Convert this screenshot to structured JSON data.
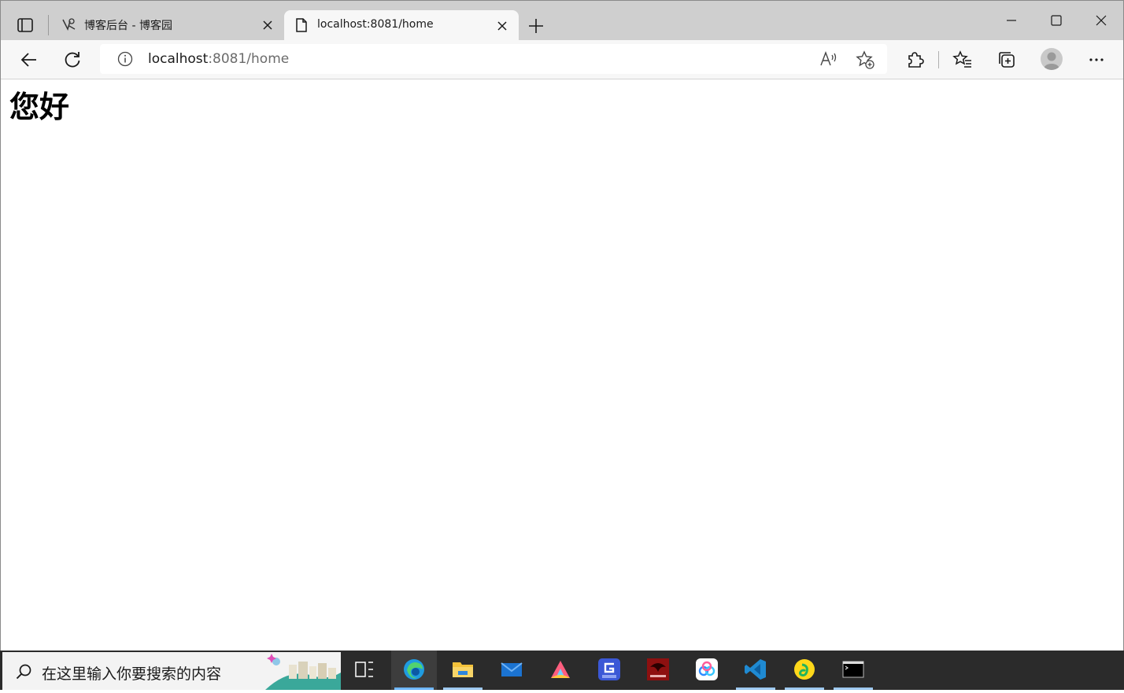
{
  "browser": {
    "tabs": [
      {
        "title": "博客后台 - 博客园",
        "active": false,
        "favicon": "cnblogs-icon"
      },
      {
        "title": "localhost:8081/home",
        "active": true,
        "favicon": "page-icon"
      }
    ],
    "address_bar": {
      "host": "localhost",
      "rest": ":8081/home"
    }
  },
  "page": {
    "heading": "您好"
  },
  "taskbar": {
    "search_placeholder": "在这里输入你要搜索的内容",
    "apps": [
      "task-view",
      "edge",
      "file-explorer",
      "mail",
      "arc",
      "gbox",
      "naraka",
      "baidu-netdisk",
      "vscode",
      "qq-music",
      "terminal"
    ]
  },
  "colors": {
    "tabstrip": "#cfcfcf",
    "toolbar": "#f7f7f7",
    "taskbar": "#2b2b2b",
    "accent_indicator": "#6fb7ff"
  }
}
